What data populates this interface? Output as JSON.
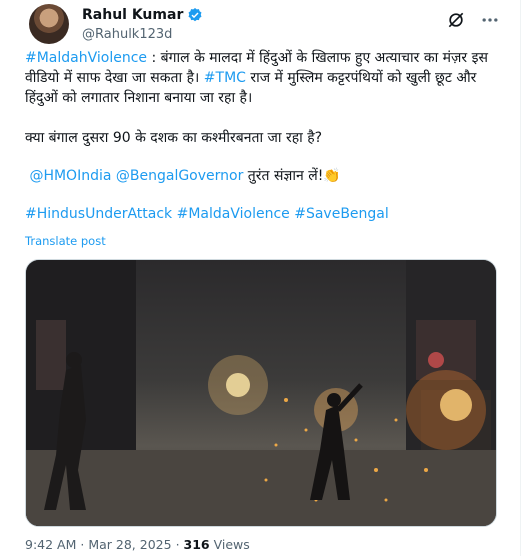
{
  "author": {
    "name": "Rahul Kumar",
    "handle": "@Rahulk123d",
    "verified_color": "#1d9bf0"
  },
  "post": {
    "hashtag_1": "#MaldahViolence",
    "text_1": " : बंगाल के मालदा में हिंदुओं के खिलाफ हुए अत्याचार का मंज़र इस वीडियो में साफ देखा जा सकता है। ",
    "hashtag_2": "#TMC",
    "text_2": " राज में मुस्लिम कट्टरपंथियों को खुली छूट और हिंदुओं को लगातार निशाना बनाया जा रहा है।",
    "question": "क्या बंगाल दुसरा 90 के दशक का कश्मीरबनता जा रहा है?",
    "mention_1": "@HMOIndia",
    "mention_2": "@BengalGovernor",
    "mention_text": " तुरंत संज्ञान लें!👏",
    "tag_1": "#HindusUnderAttack",
    "tag_2": "#MaldaViolence",
    "tag_3": "#SaveBengal",
    "translate_label": "Translate post"
  },
  "meta": {
    "time": "9:42 AM",
    "separator": "·",
    "date": "Mar 28, 2025",
    "views_count": "316",
    "views_label": "Views"
  },
  "colors": {
    "link": "#1d9bf0",
    "secondary_text": "#536471"
  }
}
